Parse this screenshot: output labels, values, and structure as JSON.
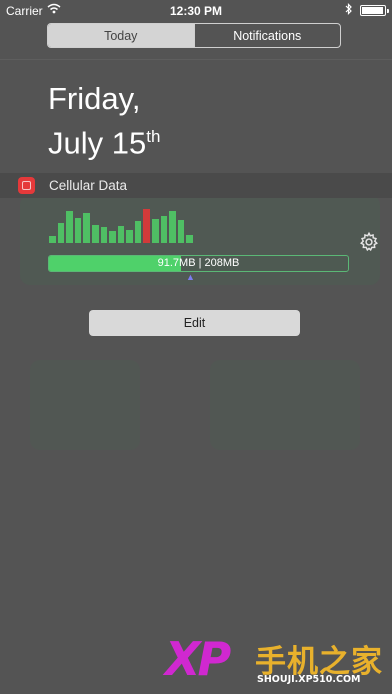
{
  "status_bar": {
    "carrier": "Carrier",
    "time": "12:30 PM",
    "battery_level": 0.95
  },
  "tabs": [
    {
      "label": "Today",
      "active": true
    },
    {
      "label": "Notifications",
      "active": false
    }
  ],
  "date": {
    "line1": "Friday,",
    "line2": "July 15",
    "ordinal": "th"
  },
  "widget": {
    "title": "Cellular Data",
    "usage_bars": [
      {
        "value": 0.18,
        "highlight": false
      },
      {
        "value": 0.5,
        "highlight": false
      },
      {
        "value": 0.8,
        "highlight": false
      },
      {
        "value": 0.62,
        "highlight": false
      },
      {
        "value": 0.75,
        "highlight": false
      },
      {
        "value": 0.45,
        "highlight": false
      },
      {
        "value": 0.4,
        "highlight": false
      },
      {
        "value": 0.3,
        "highlight": false
      },
      {
        "value": 0.42,
        "highlight": false
      },
      {
        "value": 0.33,
        "highlight": false
      },
      {
        "value": 0.55,
        "highlight": false
      },
      {
        "value": 0.85,
        "highlight": true
      },
      {
        "value": 0.6,
        "highlight": false
      },
      {
        "value": 0.68,
        "highlight": false
      },
      {
        "value": 0.8,
        "highlight": false
      },
      {
        "value": 0.58,
        "highlight": false
      },
      {
        "value": 0.2,
        "highlight": false
      }
    ],
    "bar_colors": {
      "normal": "#4fbf64",
      "highlight": "#d23a3a"
    },
    "used": "91.7MB",
    "total": "208MB",
    "usage_text": "91.7MB | 208MB",
    "used_fraction": 0.44,
    "settings_icon": "gear-icon"
  },
  "edit_button": {
    "label": "Edit"
  },
  "watermark": {
    "brand": "XP",
    "chinese": "手机之家",
    "site": "SHOUJI.XP510.COM"
  }
}
